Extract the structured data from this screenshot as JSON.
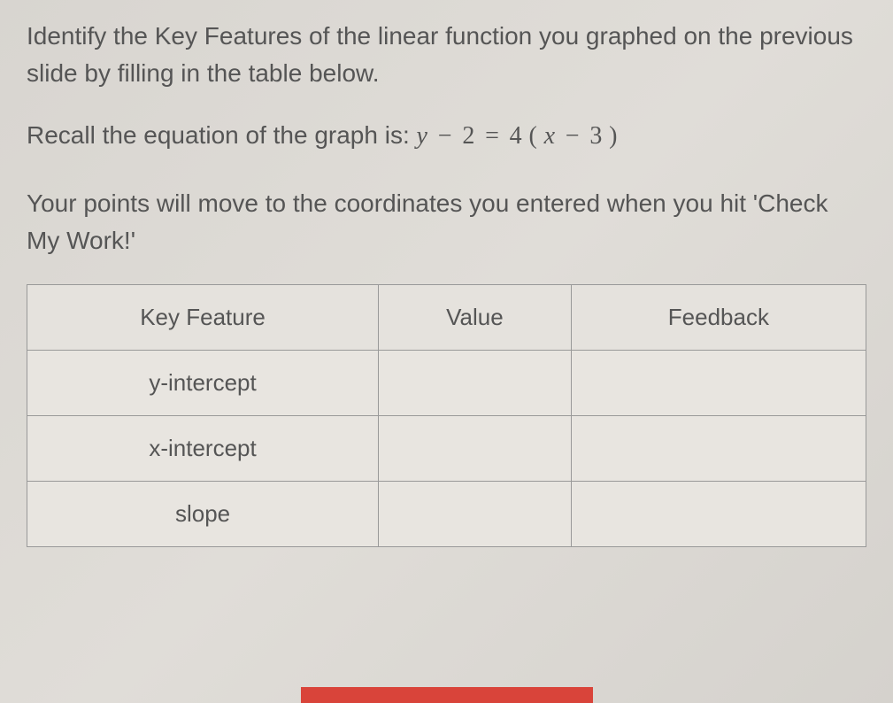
{
  "instructions": {
    "p1": "Identify the Key Features of the linear function you graphed on the previous slide by filling in the table below.",
    "p2_prefix": "Recall the equation of the graph is: ",
    "equation": {
      "y": "y",
      "minus1": "−",
      "c1": "2",
      "eq": "=",
      "c2": "4",
      "lpar": "(",
      "x": "x",
      "minus2": "−",
      "c3": "3",
      "rpar": ")"
    },
    "p3": "Your points will move to the coordinates you entered when you hit 'Check My Work!'"
  },
  "table": {
    "headers": {
      "col1": "Key Feature",
      "col2": "Value",
      "col3": "Feedback"
    },
    "rows": [
      {
        "feature": "y-intercept",
        "value": "",
        "feedback": ""
      },
      {
        "feature": "x-intercept",
        "value": "",
        "feedback": ""
      },
      {
        "feature": "slope",
        "value": "",
        "feedback": ""
      }
    ]
  }
}
